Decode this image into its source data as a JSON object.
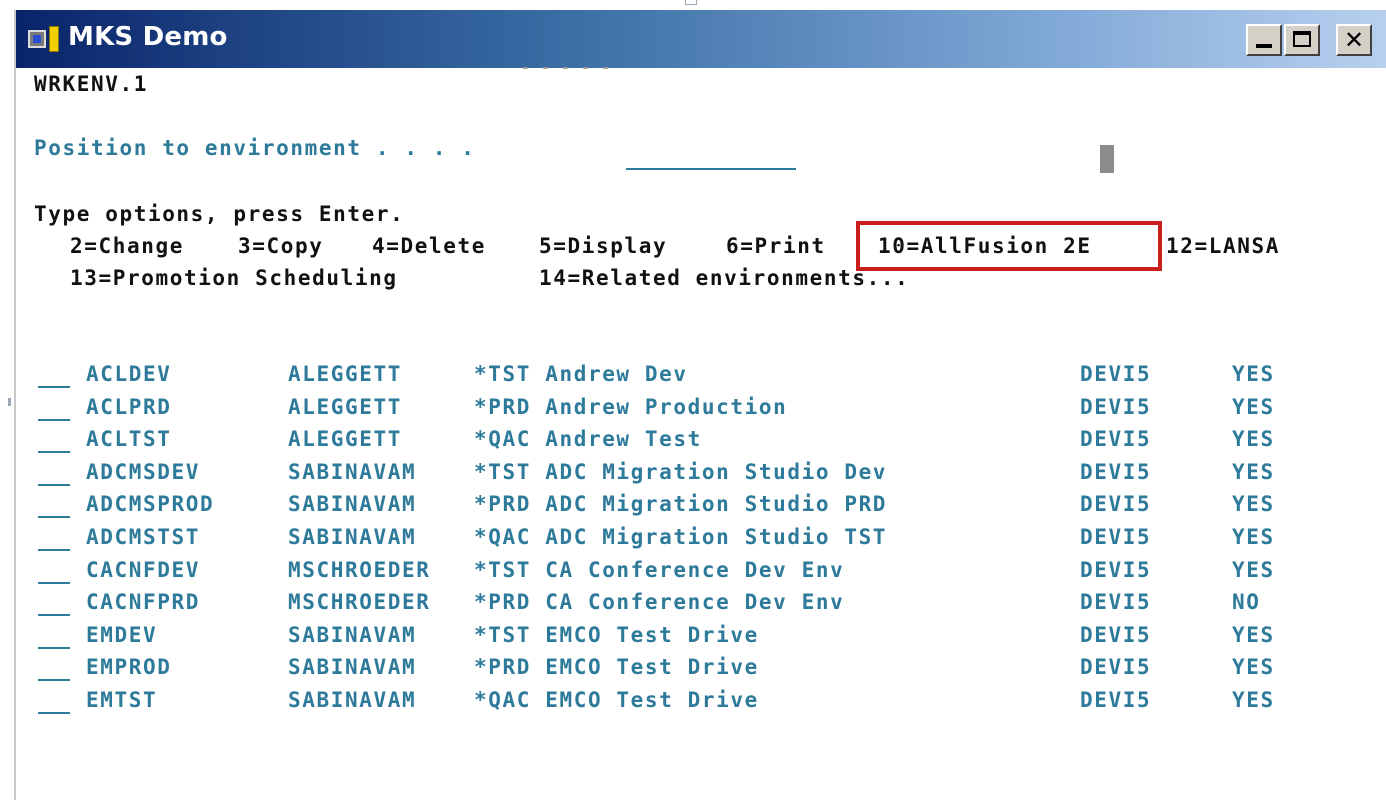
{
  "window": {
    "title": "MKS Demo",
    "controls": {
      "minimize": "minimize-button",
      "maximize": "maximize-button",
      "close": "close-button"
    }
  },
  "screen": {
    "program_id": "WRKENV.1",
    "obscured_header": "- - - - -",
    "position_prompt": "Position to environment . . . .",
    "position_value": "",
    "instructions": "Type options, press Enter.",
    "options_line1": [
      "2=Change",
      "3=Copy",
      "4=Delete",
      "5=Display",
      "6=Print",
      "10=AllFusion 2E",
      "12=LANSA"
    ],
    "options_line2": [
      "13=Promotion Scheduling",
      "14=Related environments..."
    ],
    "highlighted_option": "10=AllFusion 2E"
  },
  "environments": [
    {
      "option": "",
      "env": "ACLDEV",
      "owner": "ALEGGETT",
      "desc": "*TST Andrew Dev",
      "system": "DEVI5",
      "active": "YES"
    },
    {
      "option": "",
      "env": "ACLPRD",
      "owner": "ALEGGETT",
      "desc": "*PRD Andrew Production",
      "system": "DEVI5",
      "active": "YES"
    },
    {
      "option": "",
      "env": "ACLTST",
      "owner": "ALEGGETT",
      "desc": "*QAC Andrew Test",
      "system": "DEVI5",
      "active": "YES"
    },
    {
      "option": "",
      "env": "ADCMSDEV",
      "owner": "SABINAVAM",
      "desc": "*TST ADC Migration Studio Dev",
      "system": "DEVI5",
      "active": "YES"
    },
    {
      "option": "",
      "env": "ADCMSPROD",
      "owner": "SABINAVAM",
      "desc": "*PRD ADC Migration Studio PRD",
      "system": "DEVI5",
      "active": "YES"
    },
    {
      "option": "",
      "env": "ADCMSTST",
      "owner": "SABINAVAM",
      "desc": "*QAC ADC Migration Studio TST",
      "system": "DEVI5",
      "active": "YES"
    },
    {
      "option": "",
      "env": "CACNFDEV",
      "owner": "MSCHROEDER",
      "desc": "*TST CA Conference Dev Env",
      "system": "DEVI5",
      "active": "YES"
    },
    {
      "option": "",
      "env": "CACNFPRD",
      "owner": "MSCHROEDER",
      "desc": "*PRD CA Conference Dev Env",
      "system": "DEVI5",
      "active": "NO"
    },
    {
      "option": "",
      "env": "EMDEV",
      "owner": "SABINAVAM",
      "desc": "*TST EMCO Test Drive",
      "system": "DEVI5",
      "active": "YES"
    },
    {
      "option": "",
      "env": "EMPROD",
      "owner": "SABINAVAM",
      "desc": "*PRD EMCO Test Drive",
      "system": "DEVI5",
      "active": "YES"
    },
    {
      "option": "",
      "env": "EMTST",
      "owner": "SABINAVAM",
      "desc": "*QAC EMCO Test Drive",
      "system": "DEVI5",
      "active": "YES"
    }
  ],
  "colors": {
    "title_bar_start": "#0a246a",
    "title_bar_end": "#b8d0ee",
    "field_text": "#2e7a9a",
    "label_text": "#111111",
    "highlight_border": "#c81e1e"
  }
}
